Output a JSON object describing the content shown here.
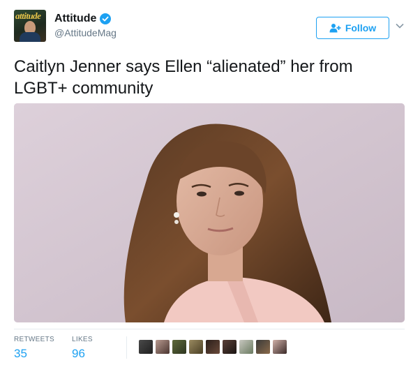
{
  "user": {
    "display_name": "Attitude",
    "handle": "@AttitudeMag",
    "avatar_masthead": "attitude"
  },
  "follow": {
    "label": "Follow"
  },
  "tweet": {
    "text": "Caitlyn Jenner says Ellen “alienated” her from LGBT+ community"
  },
  "stats": {
    "retweets_label": "RETWEETS",
    "retweets": "35",
    "likes_label": "LIKES",
    "likes": "96"
  },
  "colors": {
    "accent": "#1da1f2",
    "muted": "#657786"
  },
  "icons": [
    "verified-badge-icon",
    "follow-person-icon",
    "chevron-down-icon"
  ]
}
